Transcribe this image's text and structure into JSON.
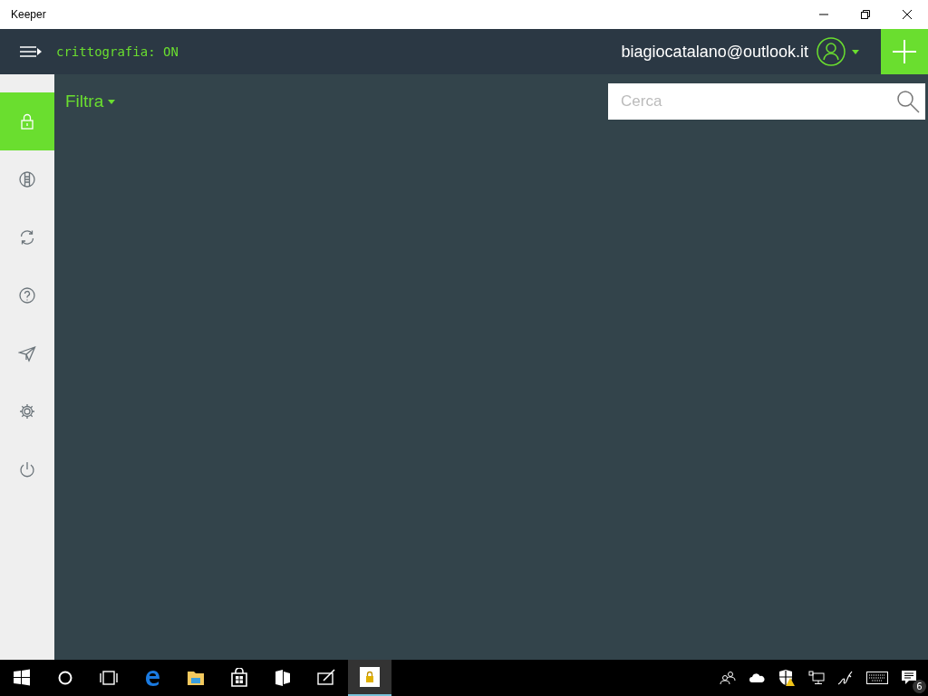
{
  "window": {
    "title": "Keeper"
  },
  "topbar": {
    "encryption": "crittografia: ON",
    "account": "biagiocatalano@outlook.it"
  },
  "filter": {
    "label": "Filtra"
  },
  "search": {
    "placeholder": "Cerca"
  },
  "sidebar": {
    "items": [
      {
        "kind": "lock",
        "selected": true
      },
      {
        "kind": "shield",
        "selected": false
      },
      {
        "kind": "sync",
        "selected": false
      },
      {
        "kind": "help",
        "selected": false
      },
      {
        "kind": "send",
        "selected": false
      },
      {
        "kind": "settings",
        "selected": false
      },
      {
        "kind": "power",
        "selected": false
      }
    ]
  },
  "taskbar": {
    "apps": [
      {
        "kind": "start",
        "selected": false
      },
      {
        "kind": "cortana",
        "selected": false
      },
      {
        "kind": "taskview",
        "selected": false
      },
      {
        "kind": "edge",
        "selected": false
      },
      {
        "kind": "explorer",
        "selected": false
      },
      {
        "kind": "store",
        "selected": false
      },
      {
        "kind": "tiles",
        "selected": false
      },
      {
        "kind": "notes",
        "selected": false
      },
      {
        "kind": "keeper",
        "selected": true
      }
    ],
    "notifications": "6"
  }
}
